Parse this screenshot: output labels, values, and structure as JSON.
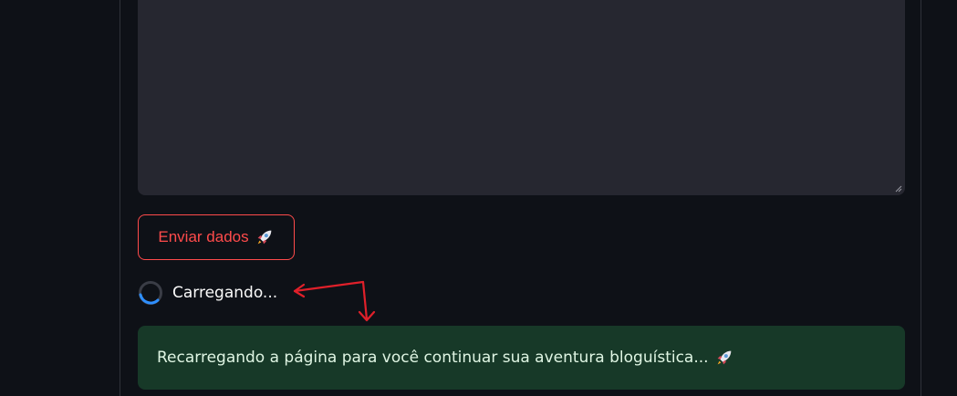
{
  "form": {
    "textarea_value": "",
    "submit_label": "Enviar dados",
    "submit_icon": "rocket-emoji"
  },
  "status": {
    "loading_text": "Carregando...",
    "success_message": "Recarregando a página para você continuar sua aventura bloguística...",
    "success_icon": "rocket-emoji"
  },
  "colors": {
    "background": "#0e1117",
    "textarea_bg": "#262730",
    "accent": "#ff4b4b",
    "spinner": "#2e8fff",
    "success_bg": "#173928",
    "annotation_arrow": "#e0202a"
  }
}
